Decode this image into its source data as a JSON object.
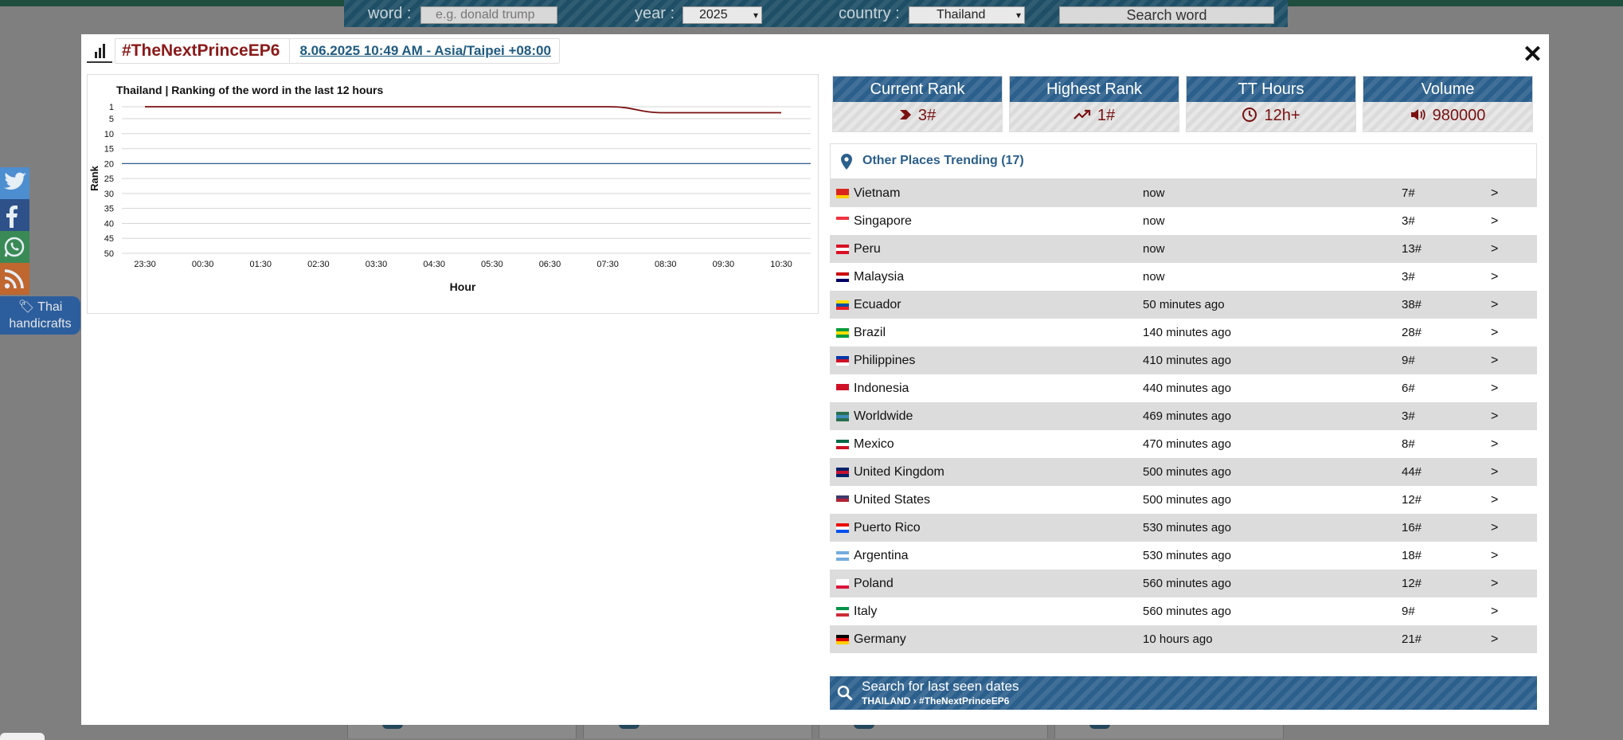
{
  "background": {
    "search": {
      "word_label": "word :",
      "word_placeholder": "e.g. donald trump",
      "year_label": "year :",
      "year_value": "2025",
      "country_label": "country :",
      "country_value": "Thailand",
      "search_button": "Search word"
    },
    "side_tag": "Thai handicrafts",
    "social": [
      "twitter-icon",
      "facebook-icon",
      "whatsapp-icon",
      "rss-icon"
    ]
  },
  "modal": {
    "close_label": "✕",
    "title": "#TheNextPrinceEP6",
    "date": "8.06.2025 10:49 AM - Asia/Taipei +08:00",
    "stats": [
      {
        "label": "Current Rank",
        "value": "3#",
        "icon": "chevron-icon"
      },
      {
        "label": "Highest Rank",
        "value": "1#",
        "icon": "trend-up-icon"
      },
      {
        "label": "TT Hours",
        "value": "12h+",
        "icon": "clock-icon"
      },
      {
        "label": "Volume",
        "value": "980000",
        "icon": "speaker-icon"
      }
    ],
    "other_places_title": "Other Places Trending (17)",
    "other_places": [
      {
        "country": "Vietnam",
        "time": "now",
        "rank": "7#",
        "go": ">",
        "flag": [
          "#da251d",
          "#da251d",
          "#ffcd00"
        ]
      },
      {
        "country": "Singapore",
        "time": "now",
        "rank": "3#",
        "go": ">",
        "flag": [
          "#ef3340",
          "#ffffff",
          "#ffffff"
        ]
      },
      {
        "country": "Peru",
        "time": "now",
        "rank": "13#",
        "go": ">",
        "flag": [
          "#d91023",
          "#ffffff",
          "#d91023"
        ]
      },
      {
        "country": "Malaysia",
        "time": "now",
        "rank": "3#",
        "go": ">",
        "flag": [
          "#cc0001",
          "#ffffff",
          "#010066"
        ]
      },
      {
        "country": "Ecuador",
        "time": "50 minutes ago",
        "rank": "38#",
        "go": ">",
        "flag": [
          "#ffdd00",
          "#034ea2",
          "#ed1c24"
        ]
      },
      {
        "country": "Brazil",
        "time": "140 minutes ago",
        "rank": "28#",
        "go": ">",
        "flag": [
          "#009c3b",
          "#ffdf00",
          "#009c3b"
        ]
      },
      {
        "country": "Philippines",
        "time": "410 minutes ago",
        "rank": "9#",
        "go": ">",
        "flag": [
          "#0038a8",
          "#ce1126",
          "#ffffff"
        ]
      },
      {
        "country": "Indonesia",
        "time": "440 minutes ago",
        "rank": "6#",
        "go": ">",
        "flag": [
          "#ce1126",
          "#ce1126",
          "#ffffff"
        ]
      },
      {
        "country": "Worldwide",
        "time": "469 minutes ago",
        "rank": "3#",
        "go": ">",
        "flag": [
          "#2a6f4f",
          "#3c8dbc",
          "#2a6f4f"
        ]
      },
      {
        "country": "Mexico",
        "time": "470 minutes ago",
        "rank": "8#",
        "go": ">",
        "flag": [
          "#006847",
          "#ffffff",
          "#ce1126"
        ]
      },
      {
        "country": "United Kingdom",
        "time": "500 minutes ago",
        "rank": "44#",
        "go": ">",
        "flag": [
          "#012169",
          "#c8102e",
          "#012169"
        ]
      },
      {
        "country": "United States",
        "time": "500 minutes ago",
        "rank": "12#",
        "go": ">",
        "flag": [
          "#3c3b6e",
          "#b22234",
          "#ffffff"
        ]
      },
      {
        "country": "Puerto Rico",
        "time": "530 minutes ago",
        "rank": "16#",
        "go": ">",
        "flag": [
          "#ed0000",
          "#ffffff",
          "#0050f0"
        ]
      },
      {
        "country": "Argentina",
        "time": "530 minutes ago",
        "rank": "18#",
        "go": ">",
        "flag": [
          "#74acdf",
          "#ffffff",
          "#74acdf"
        ]
      },
      {
        "country": "Poland",
        "time": "560 minutes ago",
        "rank": "12#",
        "go": ">",
        "flag": [
          "#ffffff",
          "#ffffff",
          "#dc143c"
        ]
      },
      {
        "country": "Italy",
        "time": "560 minutes ago",
        "rank": "9#",
        "go": ">",
        "flag": [
          "#009246",
          "#ffffff",
          "#ce2b37"
        ]
      },
      {
        "country": "Germany",
        "time": "10 hours ago",
        "rank": "21#",
        "go": ">",
        "flag": [
          "#000000",
          "#dd0000",
          "#ffce00"
        ]
      }
    ],
    "search_last_seen": {
      "label": "Search for last seen dates",
      "breadcrumb": "THAILAND › #TheNextPrinceEP6"
    }
  },
  "chart_data": {
    "type": "line",
    "title": "Thailand | Ranking of the word in the last 12 hours",
    "xlabel": "Hour",
    "ylabel": "Rank",
    "categories": [
      "23:30",
      "00:30",
      "01:30",
      "02:30",
      "03:30",
      "04:30",
      "05:30",
      "06:30",
      "07:30",
      "08:30",
      "09:30",
      "10:30"
    ],
    "y_ticks": [
      1,
      5,
      10,
      15,
      20,
      25,
      30,
      35,
      40,
      45,
      50
    ],
    "ylim": [
      50,
      1
    ],
    "y_reversed": true,
    "grid": true,
    "series": [
      {
        "color": "#7a1111",
        "values": [
          1,
          1,
          1,
          1,
          1,
          1,
          1,
          1,
          1,
          3,
          3,
          3
        ]
      }
    ],
    "reference_line": {
      "value": 20,
      "color": "#2b5f8c"
    }
  }
}
